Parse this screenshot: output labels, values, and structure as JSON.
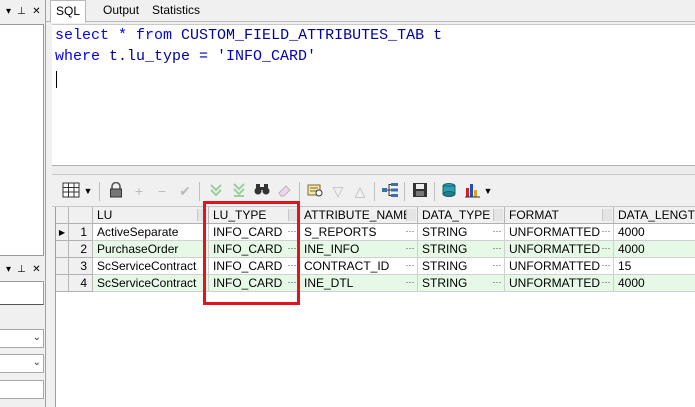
{
  "tabs": [
    "SQL",
    "Output",
    "Statistics"
  ],
  "editor": {
    "line1": {
      "kw1": "select",
      "rest1": " * ",
      "kw2": "from",
      "obj": " CUSTOM_FIELD_ATTRIBUTES_TAB",
      "alias": " t"
    },
    "line2": {
      "kw": "where",
      "expr": " t.lu_type = ",
      "str": "'INFO_CARD'"
    }
  },
  "grid": {
    "columns": [
      "LU",
      "LU_TYPE",
      "ATTRIBUTE_NAME",
      "DATA_TYPE",
      "FORMAT",
      "DATA_LENGTH"
    ],
    "rows": [
      {
        "num": "1",
        "LU": "ActiveSeparate",
        "LU_TYPE": "INFO_CARD",
        "ATTRIBUTE_NAME": "S_REPORTS",
        "DATA_TYPE": "STRING",
        "FORMAT": "UNFORMATTED",
        "DATA_LENGTH": "4000"
      },
      {
        "num": "2",
        "LU": "PurchaseOrder",
        "LU_TYPE": "INFO_CARD",
        "ATTRIBUTE_NAME": "INE_INFO",
        "DATA_TYPE": "STRING",
        "FORMAT": "UNFORMATTED",
        "DATA_LENGTH": "4000"
      },
      {
        "num": "3",
        "LU": "ScServiceContract",
        "LU_TYPE": "INFO_CARD",
        "ATTRIBUTE_NAME": "CONTRACT_ID",
        "DATA_TYPE": "STRING",
        "FORMAT": "UNFORMATTED",
        "DATA_LENGTH": "15"
      },
      {
        "num": "4",
        "LU": "ScServiceContract",
        "LU_TYPE": "INFO_CARD",
        "ATTRIBUTE_NAME": "INE_DTL",
        "DATA_TYPE": "STRING",
        "FORMAT": "UNFORMATTED",
        "DATA_LENGTH": "4000"
      }
    ]
  },
  "icons": {
    "grid_menu": "grid-icon",
    "lock": "lock-icon",
    "add": "plus-icon",
    "remove": "minus-icon",
    "post": "check-icon",
    "fetch_next": "fetch-next-icon",
    "fetch_last": "fetch-last-icon",
    "find": "binoculars-icon",
    "clear": "eraser-icon",
    "query_by_example": "qbe-icon",
    "filter": "filter-icon",
    "sort_up": "triangle-up-icon",
    "tree": "tree-icon",
    "save": "save-icon",
    "export": "export-icon",
    "chart": "chart-icon"
  },
  "colors": {
    "highlight": "#e1141e",
    "row_alt": "#e6f9e6",
    "keyword": "#0000ff"
  }
}
